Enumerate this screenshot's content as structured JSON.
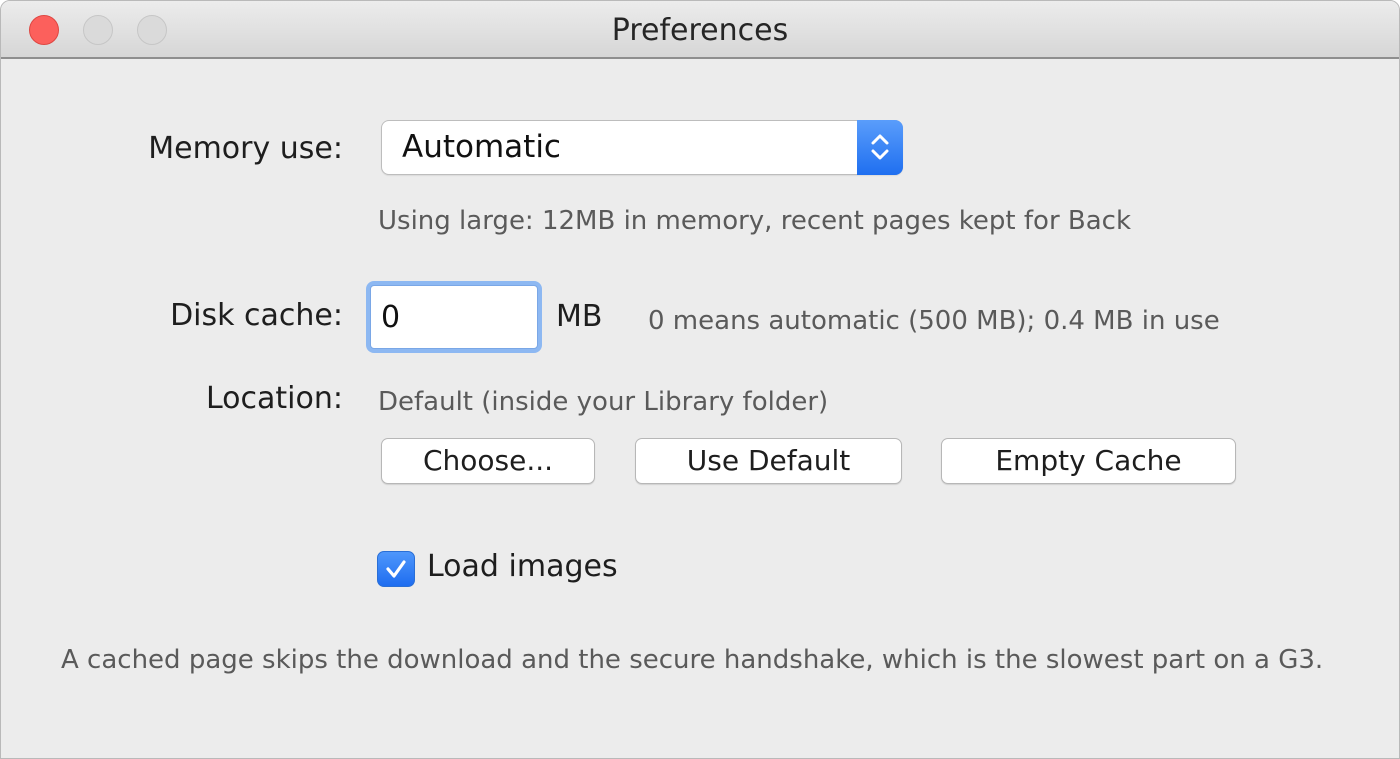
{
  "window": {
    "title": "Preferences"
  },
  "memory": {
    "label": "Memory use:",
    "selected": "Automatic",
    "hint": "Using large: 12MB in memory, recent pages kept for Back"
  },
  "disk_cache": {
    "label": "Disk cache:",
    "value": "0",
    "unit": "MB",
    "hint": "0 means automatic (500 MB); 0.4 MB in use"
  },
  "location": {
    "label": "Location:",
    "value": "Default (inside your Library folder)",
    "buttons": {
      "choose": "Choose...",
      "use_default": "Use Default",
      "empty_cache": "Empty Cache"
    }
  },
  "load_images": {
    "label": "Load images",
    "checked": true
  },
  "footer": {
    "text": "A cached page skips the download and the secure handshake, which is the slowest part on a G3."
  },
  "colors": {
    "accent": "#2f7cf6",
    "close_button": "#fc605c",
    "window_bg": "#ececec"
  },
  "icons": {
    "select_arrows": "up-down-chevron-icon",
    "checkbox": "checkmark-icon"
  }
}
